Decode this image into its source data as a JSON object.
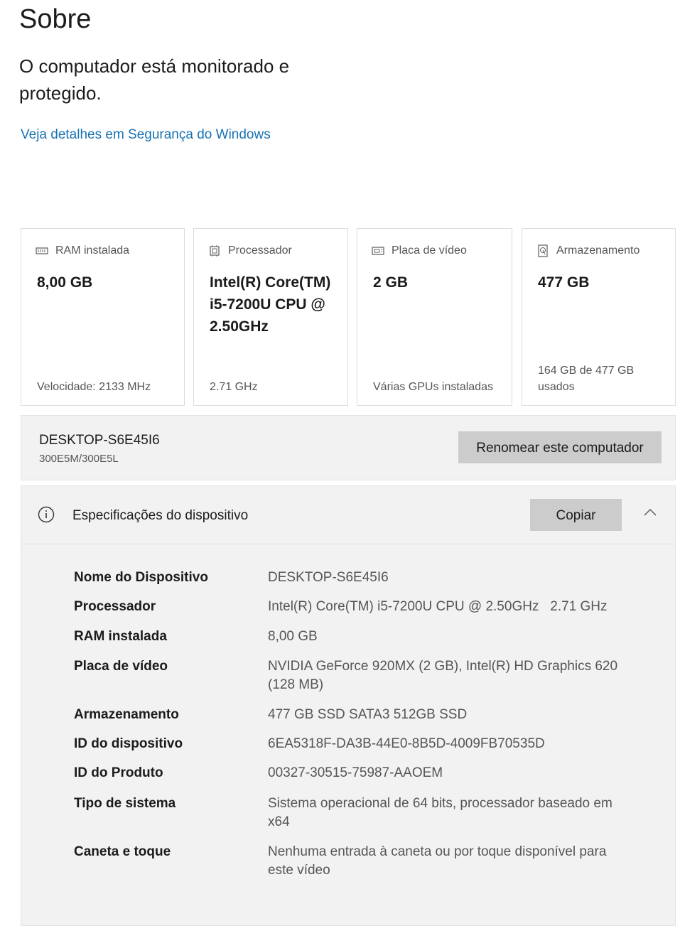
{
  "page": {
    "title": "Sobre",
    "status": "O computador está monitorado e protegido.",
    "security_link": "Veja detalhes em Segurança do Windows"
  },
  "cards": [
    {
      "icon": "ram-icon",
      "label": "RAM instalada",
      "value": "8,00 GB",
      "footer": "Velocidade: 2133 MHz"
    },
    {
      "icon": "processor-icon",
      "label": "Processador",
      "value": "Intel(R) Core(TM) i5-7200U CPU @ 2.50GHz",
      "footer": "2.71 GHz"
    },
    {
      "icon": "graphics-card-icon",
      "label": "Placa de vídeo",
      "value": "2 GB",
      "footer": "Várias GPUs instaladas"
    },
    {
      "icon": "storage-icon",
      "label": "Armazenamento",
      "value": "477 GB",
      "footer": "164 GB de 477 GB usados"
    }
  ],
  "device": {
    "name": "DESKTOP-S6E45I6",
    "model": "300E5M/300E5L",
    "rename_label": "Renomear este computador"
  },
  "specs": {
    "title": "Especificações do dispositivo",
    "copy_label": "Copiar",
    "rows": [
      {
        "key": "Nome do Dispositivo",
        "value": "DESKTOP-S6E45I6"
      },
      {
        "key": "Processador",
        "value": "Intel(R) Core(TM) i5-7200U CPU @ 2.50GHz   2.71 GHz"
      },
      {
        "key": "RAM instalada",
        "value": "8,00 GB"
      },
      {
        "key": "Placa de vídeo",
        "value": "NVIDIA GeForce 920MX (2 GB), Intel(R) HD Graphics 620 (128 MB)"
      },
      {
        "key": "Armazenamento",
        "value": "477 GB SSD SATA3 512GB SSD"
      },
      {
        "key": "ID do dispositivo",
        "value": "6EA5318F-DA3B-44E0-8B5D-4009FB70535D"
      },
      {
        "key": "ID do Produto",
        "value": "00327-30515-75987-AAOEM"
      },
      {
        "key": "Tipo de sistema",
        "value": "Sistema operacional de 64 bits, processador baseado em x64"
      },
      {
        "key": "Caneta e toque",
        "value": "Nenhuma entrada à caneta ou por toque disponível para este vídeo"
      }
    ]
  },
  "colors": {
    "link": "#1a73b4",
    "button": "#cccccc",
    "panel": "#f2f2f2"
  }
}
